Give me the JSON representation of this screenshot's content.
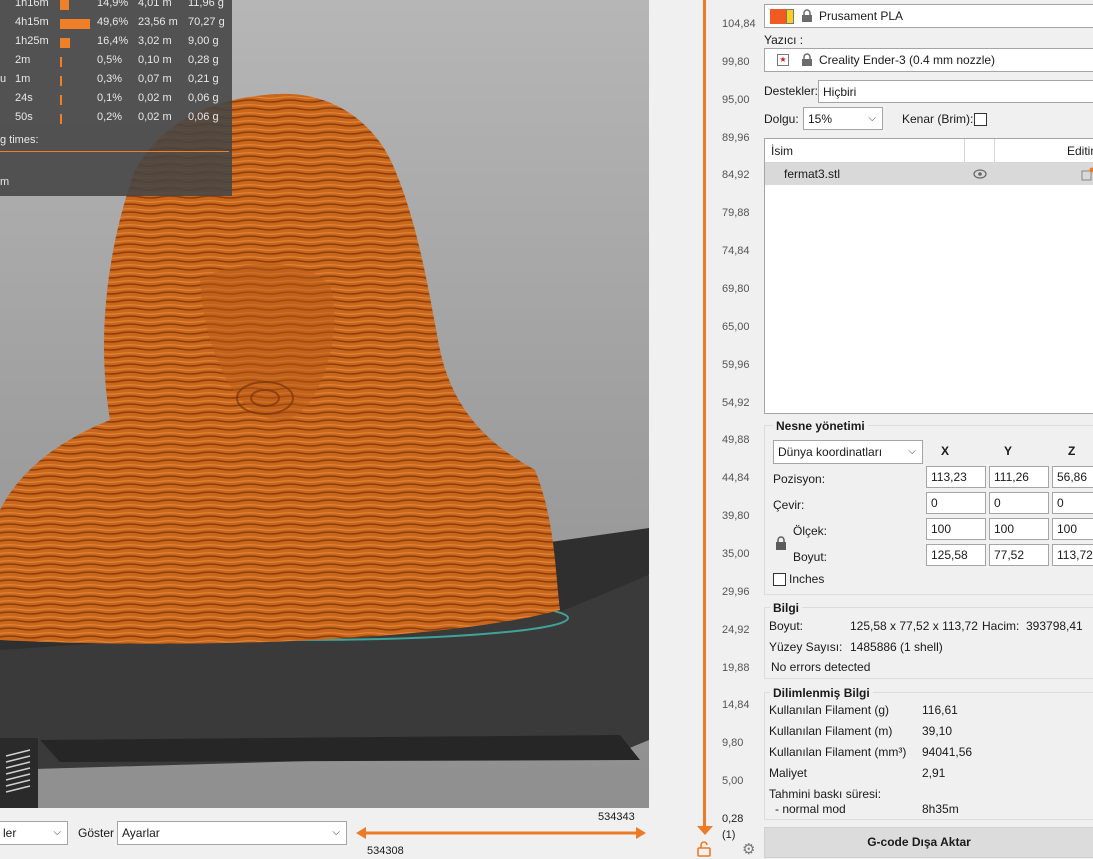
{
  "stats": {
    "rows": [
      {
        "time": "1h16m",
        "pct": "14,9%",
        "len": "4,01 m",
        "weight": "11,96 g",
        "bar": 0.149
      },
      {
        "time": "4h15m",
        "pct": "49,6%",
        "len": "23,56 m",
        "weight": "70,27 g",
        "bar": 0.496
      },
      {
        "time": "1h25m",
        "pct": "16,4%",
        "len": "3,02 m",
        "weight": "9,00 g",
        "bar": 0.164
      },
      {
        "time": "2m",
        "pct": "0,5%",
        "len": "0,10 m",
        "weight": "0,28 g",
        "bar": 0.005
      },
      {
        "time": "1m",
        "pct": "0,3%",
        "len": "0,07 m",
        "weight": "0,21 g",
        "bar": 0.003
      },
      {
        "time": "24s",
        "pct": "0,1%",
        "len": "0,02 m",
        "weight": "0,06 g",
        "bar": 0.001
      },
      {
        "time": "50s",
        "pct": "0,2%",
        "len": "0,02 m",
        "weight": "0,06 g",
        "bar": 0.002
      }
    ],
    "row_prefix_u": "u",
    "times_label": "g times:",
    "tail_m": "m"
  },
  "bottom": {
    "left_combo": "ler",
    "show_label": "Göster",
    "show_combo": "Ayarlar",
    "range_top": "534343",
    "range_bottom": "534308"
  },
  "vslider": {
    "ticks": [
      "104,84",
      "99,80",
      "95,00",
      "89,96",
      "84,92",
      "79,88",
      "74,84",
      "69,80",
      "65,00",
      "59,96",
      "54,92",
      "49,88",
      "44,84",
      "39,80",
      "35,00",
      "29,96",
      "24,92",
      "19,88",
      "14,84",
      "9,80",
      "5,00",
      "0,28"
    ],
    "bottom_index": "(1)"
  },
  "panel": {
    "filament": "Prusament PLA",
    "filament_color": "#f15a22",
    "printer_label": "Yazıcı :",
    "printer": "Creality Ender-3 (0.4 mm nozzle)",
    "supports_label": "Destekler:",
    "supports_value": "Hiçbiri",
    "infill_label": "Dolgu:",
    "infill_value": "15%",
    "brim_label": "Kenar (Brim):",
    "list_header_name": "İsim",
    "list_header_edit": "Editin",
    "object_name": "fermat3.stl",
    "manip": {
      "title": "Nesne yönetimi",
      "coord": "Dünya koordinatları",
      "x": "X",
      "y": "Y",
      "z": "Z",
      "pos_label": "Pozisyon:",
      "pos": [
        "113,23",
        "111,26",
        "56,86"
      ],
      "rot_label": "Çevir:",
      "rot": [
        "0",
        "0",
        "0"
      ],
      "scale_label": "Ölçek:",
      "scale": [
        "100",
        "100",
        "100"
      ],
      "size_label": "Boyut:",
      "size": [
        "125,58",
        "77,52",
        "113,72"
      ],
      "inches": "Inches"
    },
    "info": {
      "title": "Bilgi",
      "size_label": "Boyut:",
      "size": "125,58 x 77,52 x 113,72",
      "volume_label": "Hacim:",
      "volume": "393798,41",
      "facets_label": "Yüzey Sayısı:",
      "facets": "1485886 (1 shell)",
      "errors": "No errors detected"
    },
    "sliced": {
      "title": "Dilimlenmiş Bilgi",
      "rows": [
        {
          "label": "Kullanılan Filament (g)",
          "value": "116,61"
        },
        {
          "label": "Kullanılan Filament (m)",
          "value": "39,10"
        },
        {
          "label": "Kullanılan Filament (mm³)",
          "value": "94041,56"
        },
        {
          "label": "Maliyet",
          "value": "2,91"
        }
      ],
      "time_label": "Tahmini baskı süresi:",
      "mode_label": "- normal mod",
      "mode_value": "8h35m"
    },
    "export_button": "G-code Dışa Aktar"
  },
  "colors": {
    "accent": "#ed7a26",
    "model": "#c8651c"
  }
}
